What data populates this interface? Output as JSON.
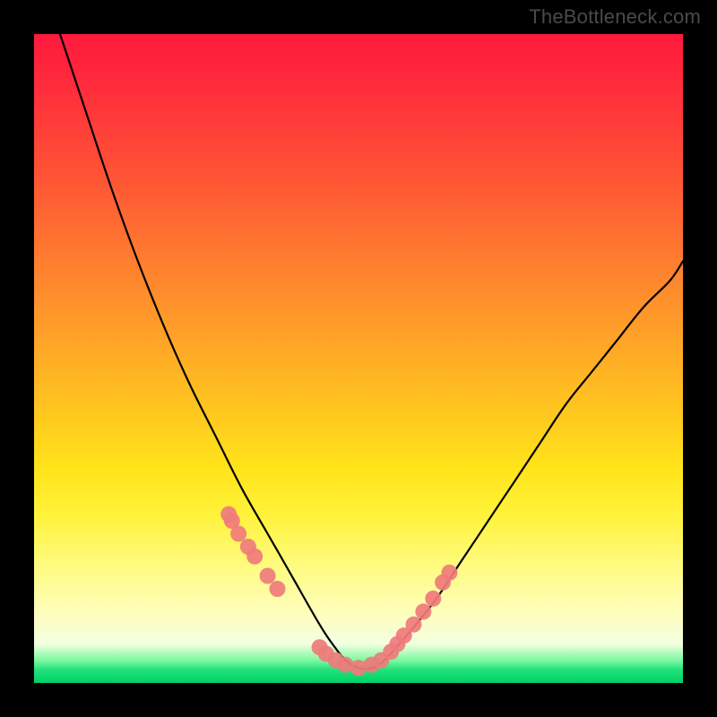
{
  "watermark": "TheBottleneck.com",
  "chart_data": {
    "type": "line",
    "title": "",
    "xlabel": "",
    "ylabel": "",
    "xlim": [
      0,
      100
    ],
    "ylim": [
      0,
      100
    ],
    "grid": false,
    "series": [
      {
        "name": "curve",
        "color": "#000000",
        "x": [
          4,
          8,
          12,
          16,
          20,
          24,
          28,
          32,
          36,
          40,
          44,
          46,
          48,
          50,
          52,
          54,
          58,
          62,
          66,
          70,
          74,
          78,
          82,
          86,
          90,
          94,
          98,
          100
        ],
        "y": [
          100,
          88,
          76,
          65,
          55,
          46,
          38,
          30,
          23,
          16,
          9,
          6,
          3.5,
          2.3,
          2.3,
          3.5,
          8,
          13,
          19,
          25,
          31,
          37,
          43,
          48,
          53,
          58,
          62,
          65
        ]
      },
      {
        "name": "markers",
        "color": "#ef7b7b",
        "type": "scatter",
        "x": [
          30,
          30.5,
          31.5,
          33,
          34,
          36,
          37.5,
          44,
          45,
          46.5,
          48,
          50,
          52,
          53.5,
          55,
          56,
          57,
          58.5,
          60,
          61.5,
          63,
          64
        ],
        "y": [
          26,
          25,
          23,
          21,
          19.5,
          16.5,
          14.5,
          5.5,
          4.5,
          3.5,
          2.8,
          2.3,
          2.8,
          3.5,
          4.8,
          6,
          7.3,
          9,
          11,
          13,
          15.5,
          17
        ]
      }
    ],
    "gradient_stops": [
      {
        "pos": 0,
        "color": "#ff1a3d"
      },
      {
        "pos": 22,
        "color": "#ff5435"
      },
      {
        "pos": 46,
        "color": "#ffa028"
      },
      {
        "pos": 67,
        "color": "#ffe41a"
      },
      {
        "pos": 90,
        "color": "#fdfec2"
      },
      {
        "pos": 98,
        "color": "#22e07a"
      },
      {
        "pos": 100,
        "color": "#00d067"
      }
    ]
  }
}
